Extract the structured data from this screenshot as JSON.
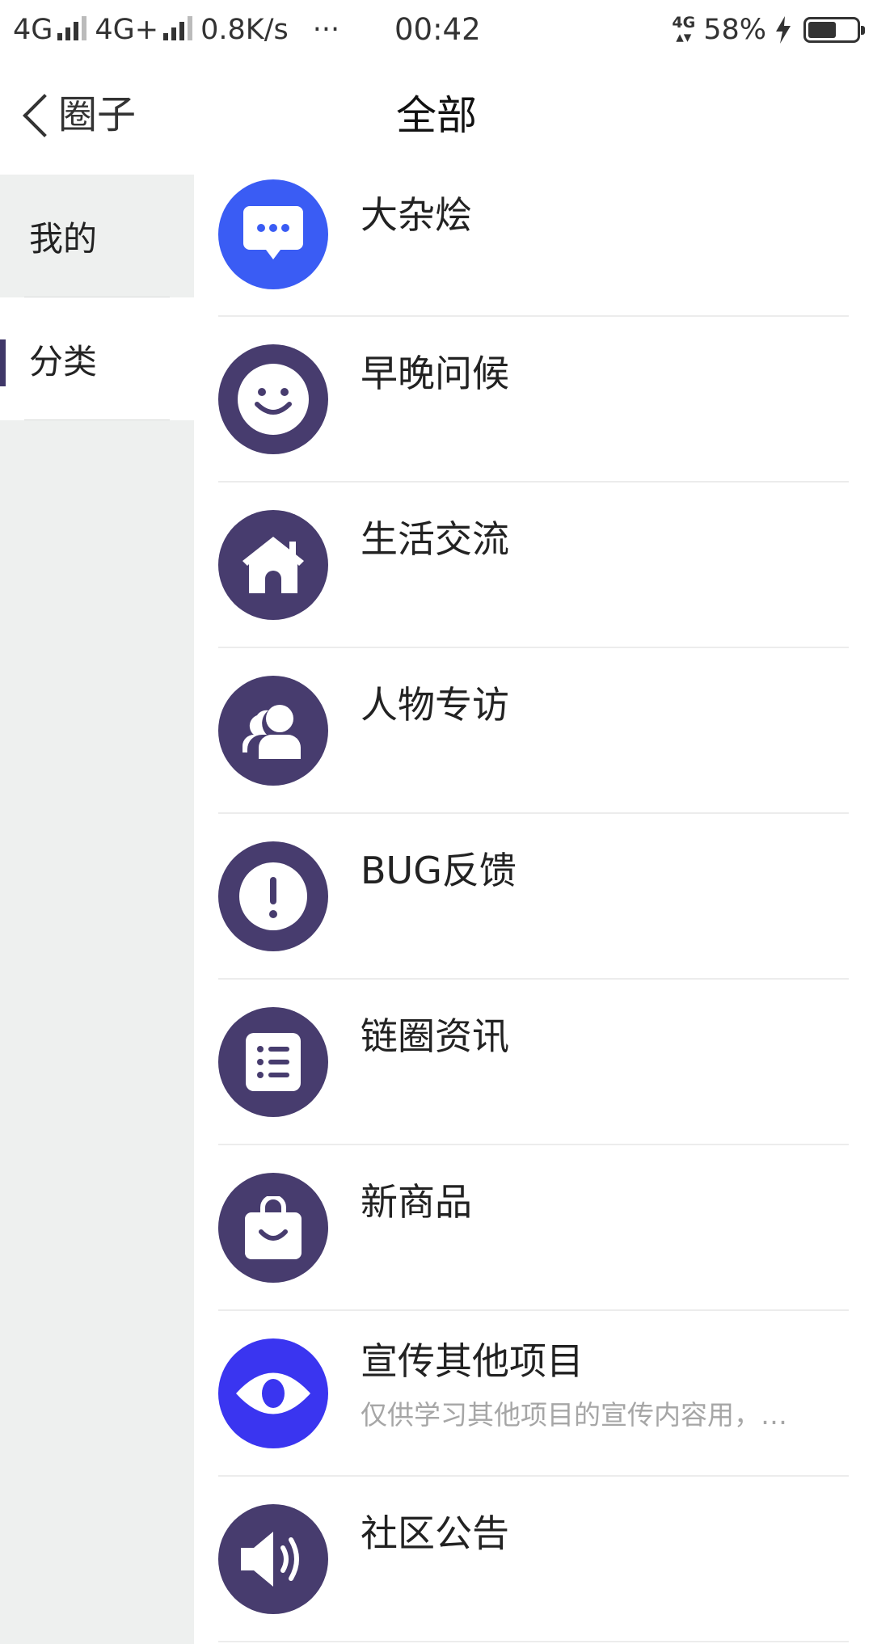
{
  "status_bar": {
    "carrier1": "4G",
    "carrier2": "4G+",
    "speed": "0.8K/s",
    "more": "···",
    "time": "00:42",
    "net_badge": "4G",
    "battery": "58%",
    "battery_level": 0.58
  },
  "header": {
    "back_label": "圈子",
    "title": "全部"
  },
  "sidebar": {
    "items": [
      {
        "label": "我的",
        "active": false
      },
      {
        "label": "分类",
        "active": true
      }
    ]
  },
  "categories": [
    {
      "title": "大杂烩",
      "icon": "chat-bubble-icon",
      "color": "#3a5cf4"
    },
    {
      "title": "早晚问候",
      "icon": "smile-icon",
      "color": "#473c6e"
    },
    {
      "title": "生活交流",
      "icon": "home-icon",
      "color": "#473c6e"
    },
    {
      "title": "人物专访",
      "icon": "users-icon",
      "color": "#473c6e"
    },
    {
      "title": "BUG反馈",
      "icon": "alert-icon",
      "color": "#473c6e"
    },
    {
      "title": "链圈资讯",
      "icon": "news-list-icon",
      "color": "#473c6e"
    },
    {
      "title": "新商品",
      "icon": "shopping-bag-icon",
      "color": "#473c6e"
    },
    {
      "title": "宣传其他项目",
      "description": "仅供学习其他项目的宣传内容用，…",
      "icon": "eye-icon",
      "color": "#3a35f0"
    },
    {
      "title": "社区公告",
      "icon": "speaker-icon",
      "color": "#473c6e"
    }
  ]
}
